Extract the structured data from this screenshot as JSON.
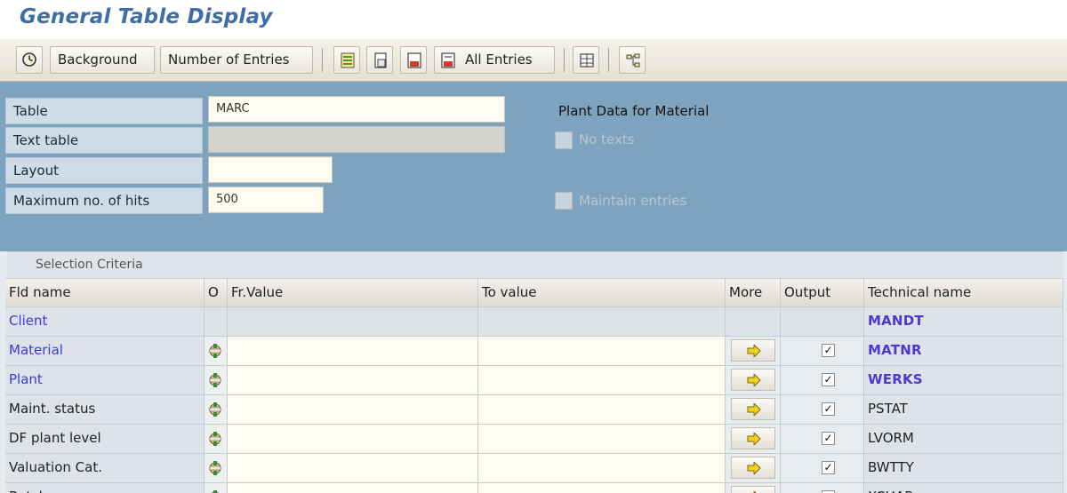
{
  "window": {
    "title": "General Table Display"
  },
  "toolbar": {
    "execute_icon": "execute-clock-icon",
    "background_label": "Background",
    "number_of_entries_label": "Number of Entries",
    "all_entries_label": "All Entries"
  },
  "header": {
    "table_label": "Table",
    "table_value": "MARC",
    "text_table_label": "Text table",
    "text_table_value": "",
    "layout_label": "Layout",
    "layout_value": "",
    "max_hits_label": "Maximum no. of hits",
    "max_hits_value": "500",
    "table_description": "Plant Data for Material",
    "no_texts_label": "No texts",
    "maintain_entries_label": "Maintain entries"
  },
  "selection": {
    "section_title": "Selection Criteria",
    "columns": {
      "name": "Fld name",
      "op": "O",
      "from": "Fr.Value",
      "to": "To value",
      "more": "More",
      "output": "Output",
      "tech": "Technical name"
    },
    "rows": [
      {
        "name": "Client",
        "tech": "MANDT",
        "key": true,
        "editable": false,
        "output": false
      },
      {
        "name": "Material",
        "tech": "MATNR",
        "key": true,
        "editable": true,
        "output": true
      },
      {
        "name": "Plant",
        "tech": "WERKS",
        "key": true,
        "editable": true,
        "output": true
      },
      {
        "name": "Maint. status",
        "tech": "PSTAT",
        "key": false,
        "editable": true,
        "output": true
      },
      {
        "name": "DF plant level",
        "tech": "LVORM",
        "key": false,
        "editable": true,
        "output": true
      },
      {
        "name": "Valuation Cat.",
        "tech": "BWTTY",
        "key": false,
        "editable": true,
        "output": true
      },
      {
        "name": "Batches",
        "tech": "XCHAR",
        "key": false,
        "editable": true,
        "output": true
      }
    ]
  },
  "colors": {
    "title": "#3f6ea6",
    "header_bg": "#7ea3bf",
    "key_field": "#3a3ad8"
  }
}
